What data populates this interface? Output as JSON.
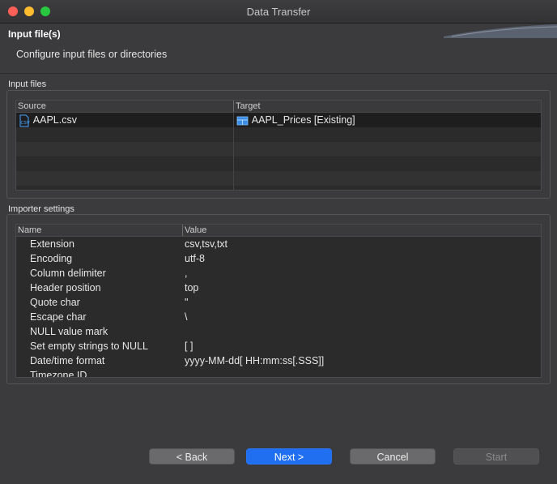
{
  "window": {
    "title": "Data Transfer"
  },
  "header": {
    "title": "Input file(s)",
    "description": "Configure input files or directories"
  },
  "input_files": {
    "group_label": "Input files",
    "columns": [
      "Source",
      "Target"
    ],
    "rows": [
      {
        "source": "AAPL.csv",
        "target": "AAPL_Prices [Existing]"
      }
    ]
  },
  "importer": {
    "group_label": "Importer settings",
    "columns": [
      "Name",
      "Value"
    ],
    "rows": [
      {
        "name": "Extension",
        "value": "csv,tsv,txt"
      },
      {
        "name": "Encoding",
        "value": "utf-8"
      },
      {
        "name": "Column delimiter",
        "value": ","
      },
      {
        "name": "Header position",
        "value": "top"
      },
      {
        "name": "Quote char",
        "value": "\""
      },
      {
        "name": "Escape char",
        "value": "\\"
      },
      {
        "name": "NULL value mark",
        "value": ""
      },
      {
        "name": "Set empty strings to NULL",
        "value": "[  ]"
      },
      {
        "name": "Date/time format",
        "value": "yyyy-MM-dd[ HH:mm:ss[.SSS]]"
      },
      {
        "name": "Timezone ID",
        "value": ""
      }
    ]
  },
  "buttons": {
    "back": "< Back",
    "next": "Next >",
    "cancel": "Cancel",
    "start": "Start"
  },
  "icons": {
    "file": "csv-file-icon",
    "table": "table-icon"
  },
  "colors": {
    "primary": "#1f6ff0",
    "background": "#3b3b3d"
  }
}
